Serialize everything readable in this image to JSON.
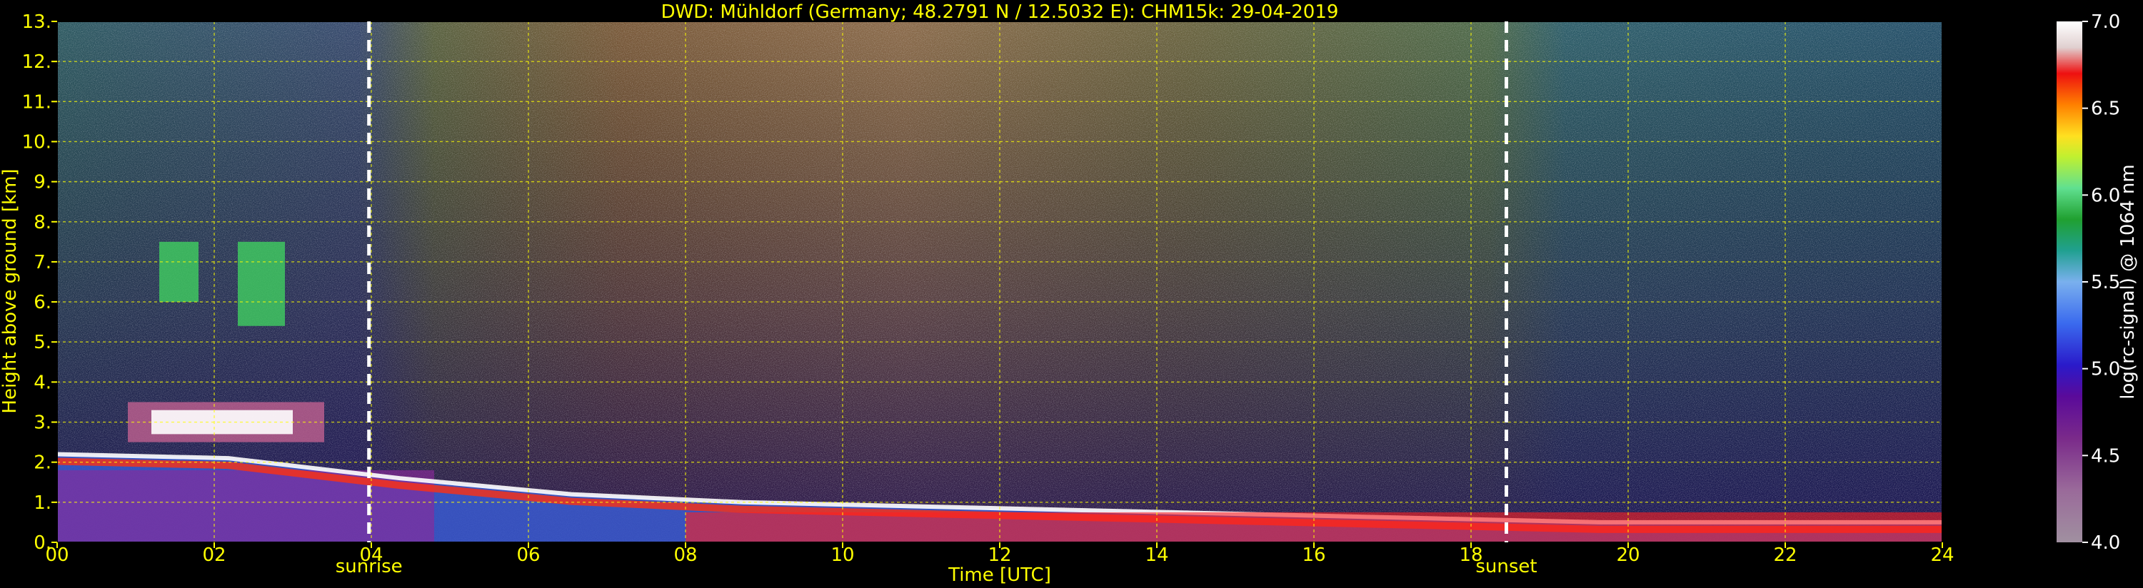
{
  "chart_data": {
    "type": "heatmap",
    "title": "DWD: Mühldorf (Germany; 48.2791 N / 12.5032 E):    CHM15k: 29-04-2019",
    "xlabel": "Time [UTC]",
    "ylabel": "Height above ground [km]",
    "x_range": [
      0,
      24
    ],
    "y_range": [
      0,
      13
    ],
    "x_ticks": [
      "00",
      "02",
      "04",
      "06",
      "08",
      "10",
      "12",
      "14",
      "16",
      "18",
      "20",
      "22",
      "24"
    ],
    "y_ticks": [
      "0.",
      "1.",
      "2.",
      "3.",
      "4.",
      "5.",
      "6.",
      "7.",
      "8.",
      "9.",
      "10.",
      "11.",
      "12.",
      "13."
    ],
    "grid": true,
    "events": [
      {
        "label": "sunrise",
        "time": 3.97
      },
      {
        "label": "sunset",
        "time": 18.45
      }
    ],
    "colorbar": {
      "label": "log(rc-signal) @ 1064 nm",
      "range": [
        4.0,
        7.0
      ],
      "ticks": [
        "4.0",
        "4.5",
        "5.0",
        "5.5",
        "6.0",
        "6.5",
        "7.0"
      ]
    },
    "features": [
      {
        "name": "boundary layer",
        "start": 0,
        "end": 24,
        "top_km": [
          2.2,
          2.1,
          1.6,
          1.2,
          1.0,
          0.9,
          0.8,
          0.7,
          0.6,
          0.5,
          0.5,
          0.5
        ]
      },
      {
        "name": "mid-level cloud",
        "start": 1.3,
        "end": 2.9,
        "base_km": 6.0,
        "top_km": 7.5
      },
      {
        "name": "cloud near 3 km",
        "start": 0.9,
        "end": 3.4,
        "base_km": 2.5,
        "top_km": 3.5
      }
    ],
    "colors": {
      "title": "#ffff00",
      "grid": "#ffff00",
      "event_line": "#ffffff"
    }
  }
}
